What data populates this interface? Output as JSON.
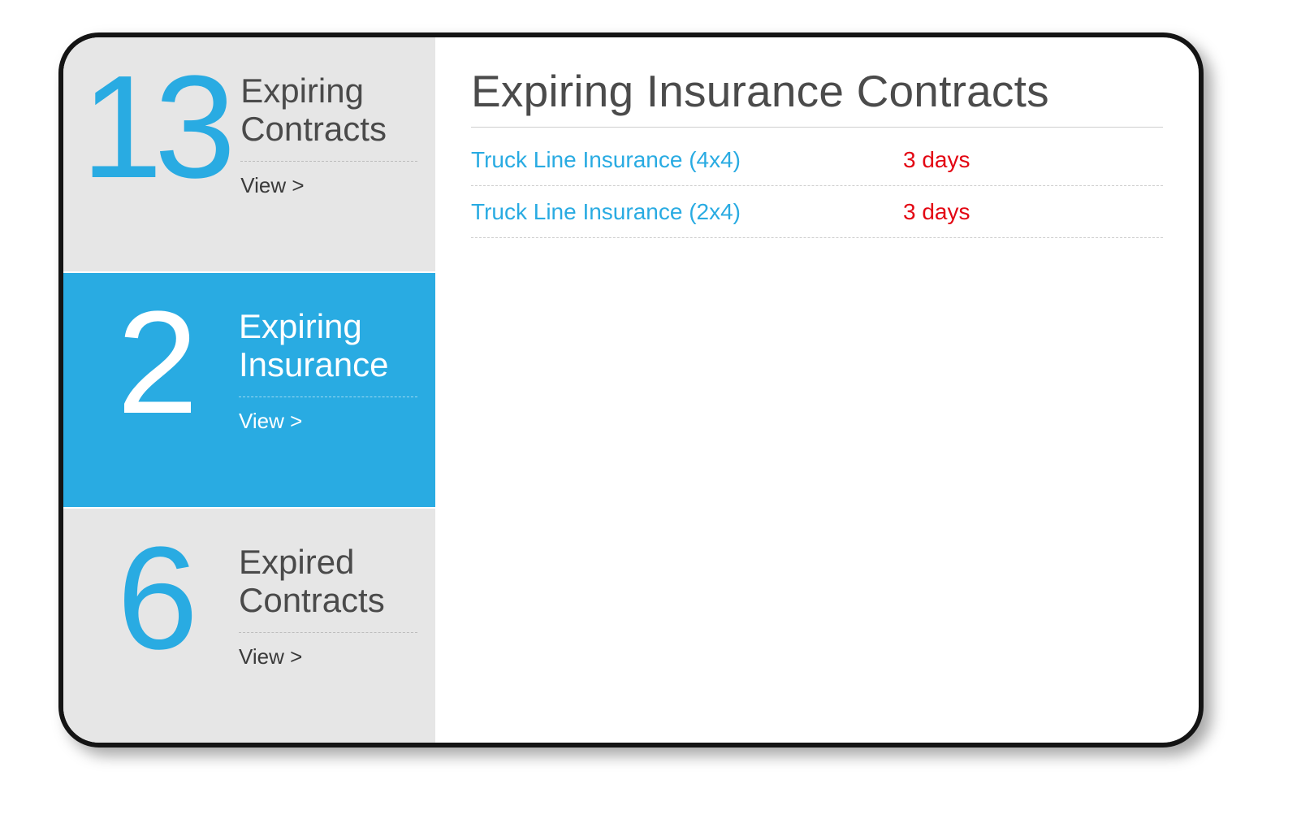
{
  "sidebar": {
    "view_label": "View >",
    "tiles": [
      {
        "count": "13",
        "title_line1": "Expiring",
        "title_line2": "Contracts",
        "active": false
      },
      {
        "count": "2",
        "title_line1": "Expiring",
        "title_line2": "Insurance",
        "active": true
      },
      {
        "count": "6",
        "title_line1": "Expired",
        "title_line2": "Contracts",
        "active": false
      }
    ]
  },
  "main": {
    "title": "Expiring Insurance Contracts",
    "rows": [
      {
        "name": "Truck Line Insurance (4x4)",
        "days": "3 days"
      },
      {
        "name": "Truck Line Insurance (2x4)",
        "days": "3 days"
      }
    ]
  }
}
